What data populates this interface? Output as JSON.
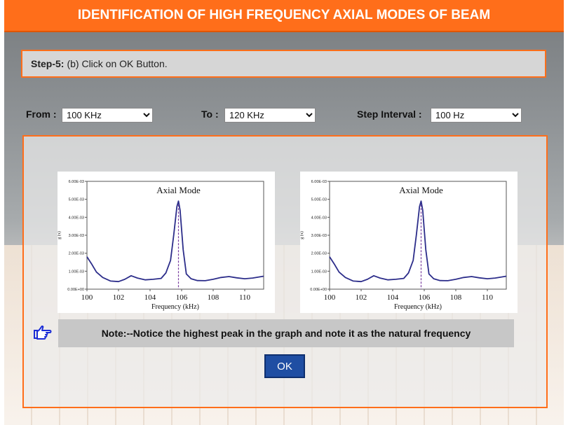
{
  "title": "IDENTIFICATION OF HIGH FREQUENCY AXIAL MODES OF BEAM",
  "step": {
    "label": "Step-5:",
    "text": "(b) Click on OK Button."
  },
  "controls": {
    "from": {
      "label": "From :",
      "value": "100 KHz"
    },
    "to": {
      "label": "To :",
      "value": "120 KHz"
    },
    "step_interval": {
      "label": "Step Interval :",
      "value": "100 Hz"
    }
  },
  "graphs": [
    {
      "title": "Axial Mode",
      "xlabel": "Frequency (kHz)",
      "ylabel": "g (x)",
      "yticks": [
        "6.00E-03",
        "5.00E-03",
        "4.00E-03",
        "3.00E-03",
        "2.00E-03",
        "1.00E-03",
        "0.00E+00"
      ],
      "xticks": [
        "100",
        "102",
        "104",
        "106",
        "108",
        "110"
      ]
    },
    {
      "title": "Axial Mode",
      "xlabel": "Frequency (kHz)",
      "ylabel": "g (x)",
      "yticks": [
        "6.00E-03",
        "5.00E-03",
        "4.00E-03",
        "3.00E-03",
        "2.00E-03",
        "1.00E-03",
        "0.00E+00"
      ],
      "xticks": [
        "100",
        "102",
        "104",
        "106",
        "108",
        "110"
      ]
    }
  ],
  "chart_data": [
    {
      "type": "line",
      "title": "Axial Mode",
      "xlabel": "Frequency (kHz)",
      "ylabel": "",
      "xlim": [
        100,
        111.2
      ],
      "ylim": [
        0,
        0.006
      ],
      "peak_x": 105.8,
      "grid": false,
      "x": [
        100,
        100.3,
        100.6,
        101,
        101.5,
        102,
        102.4,
        102.8,
        103.2,
        103.7,
        104.2,
        104.7,
        105,
        105.3,
        105.5,
        105.7,
        105.8,
        105.9,
        106.1,
        106.3,
        106.6,
        107,
        107.5,
        108,
        108.5,
        109,
        109.5,
        110,
        110.5,
        111.2
      ],
      "y": [
        0.0018,
        0.0014,
        0.00095,
        0.00065,
        0.00045,
        0.00042,
        0.00055,
        0.00075,
        0.00062,
        0.00052,
        0.00055,
        0.0006,
        0.0009,
        0.0016,
        0.003,
        0.0046,
        0.0049,
        0.0044,
        0.0022,
        0.00085,
        0.00058,
        0.00048,
        0.00047,
        0.00055,
        0.00065,
        0.0007,
        0.00063,
        0.00058,
        0.00062,
        0.00072
      ],
      "series": [
        {
          "color": "#2c2d8a"
        }
      ]
    },
    {
      "type": "line",
      "title": "Axial Mode",
      "xlabel": "Frequency (kHz)",
      "ylabel": "",
      "xlim": [
        100,
        111.2
      ],
      "ylim": [
        0,
        0.006
      ],
      "peak_x": 105.8,
      "grid": false,
      "x": [
        100,
        100.3,
        100.6,
        101,
        101.5,
        102,
        102.4,
        102.8,
        103.2,
        103.7,
        104.2,
        104.7,
        105,
        105.3,
        105.5,
        105.7,
        105.8,
        105.9,
        106.1,
        106.3,
        106.6,
        107,
        107.5,
        108,
        108.5,
        109,
        109.5,
        110,
        110.5,
        111.2
      ],
      "y": [
        0.0018,
        0.0014,
        0.00095,
        0.00065,
        0.00045,
        0.00042,
        0.00055,
        0.00075,
        0.00062,
        0.00052,
        0.00055,
        0.0006,
        0.0009,
        0.0016,
        0.003,
        0.0046,
        0.0049,
        0.0044,
        0.0022,
        0.00085,
        0.00058,
        0.00048,
        0.00047,
        0.00055,
        0.00065,
        0.0007,
        0.00063,
        0.00058,
        0.00062,
        0.00072
      ],
      "series": [
        {
          "color": "#2c2d8a"
        }
      ]
    }
  ],
  "note": "Note:--Notice the highest peak in the graph and note it as the natural frequency",
  "ok_label": "OK",
  "icons": {
    "note": "pointing-hand-icon"
  },
  "colors": {
    "accent": "#ff6e1a",
    "button": "#1f4ea3",
    "curve": "#2c2d8a",
    "peak_line": "#7a3fa0"
  }
}
